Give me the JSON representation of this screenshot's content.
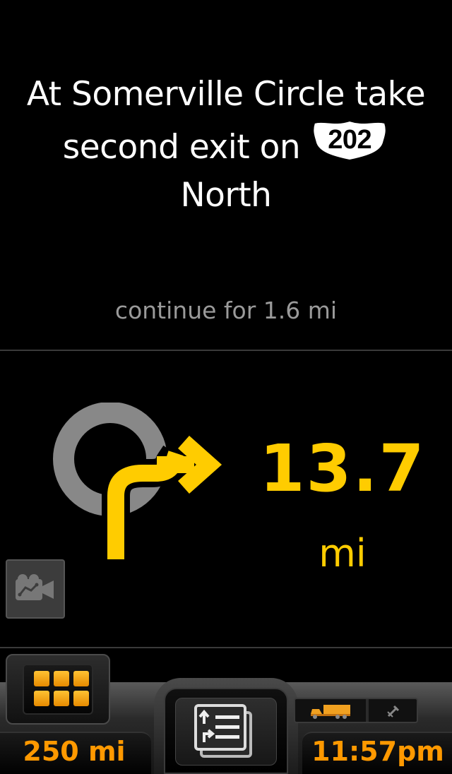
{
  "instruction": {
    "line1": "At Somerville Circle take",
    "line2_prefix": "second exit on",
    "route_shield": "202",
    "line3": "North"
  },
  "continue_text": "continue for 1.6 mi",
  "next_maneuver": {
    "icon": "roundabout-second-exit-icon",
    "distance_value": "13.7",
    "distance_unit": "mi"
  },
  "camera_button": {
    "icon": "camera-icon"
  },
  "bottom_bar": {
    "menu_icon": "grid-icon",
    "range": "250 mi",
    "list_icon": "directions-list-icon",
    "status_icons": [
      "truck-icon",
      "gps-satellite-icon"
    ],
    "time": "11:57pm"
  },
  "colors": {
    "accent_yellow": "#ffcc00",
    "accent_orange": "#ff9900",
    "roundabout_gray": "#888888"
  }
}
